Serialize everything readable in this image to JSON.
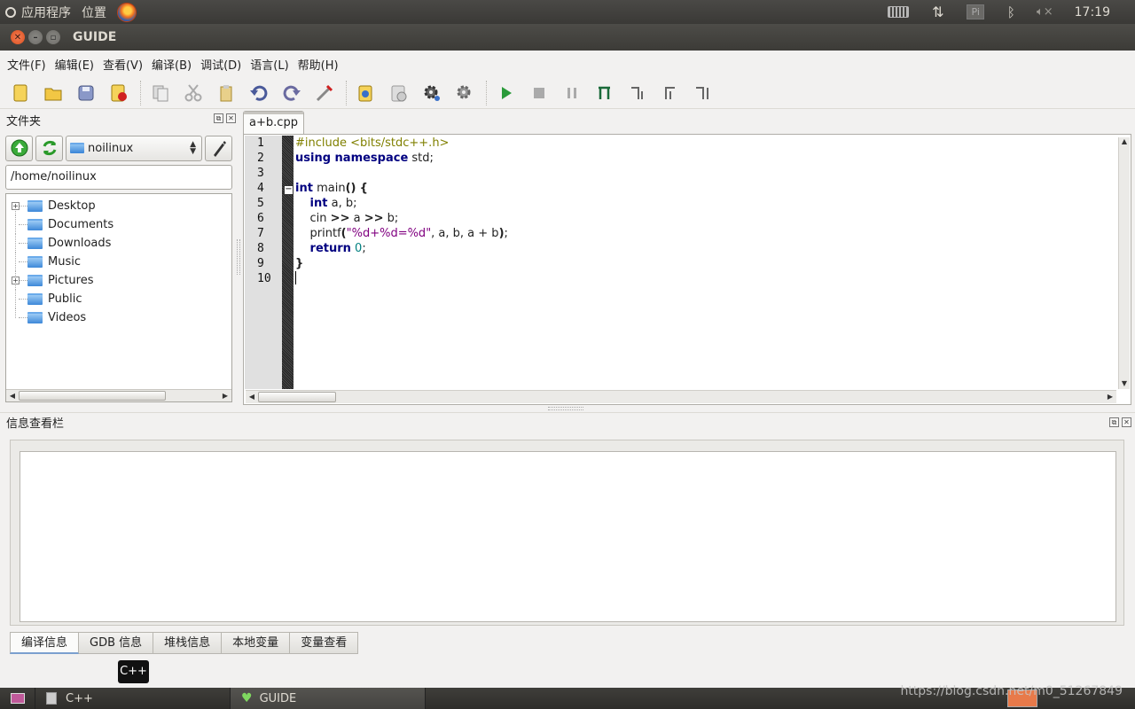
{
  "top_panel": {
    "apps_label": "应用程序",
    "places_label": "位置",
    "time": "17:19",
    "pi_label": "Pi",
    "icons": [
      "ubuntu-logo-icon",
      "firefox-icon",
      "keyboard-icon",
      "network-icon",
      "bluetooth-icon",
      "volume-muted-icon"
    ]
  },
  "window": {
    "title": "GUIDE"
  },
  "menubar": {
    "items": [
      "文件(F)",
      "编辑(E)",
      "查看(V)",
      "编译(B)",
      "调试(D)",
      "语言(L)",
      "帮助(H)"
    ]
  },
  "toolbar": {
    "buttons": [
      "new-file-icon",
      "open-file-icon",
      "save-icon",
      "close-file-icon",
      "copy-icon",
      "cut-icon",
      "paste-icon",
      "undo-icon",
      "redo-icon",
      "compile-settings-icon",
      "build-icon",
      "compile-icon",
      "settings-gear-icon",
      "run-config-icon",
      "run-icon",
      "stop-icon",
      "pause-icon",
      "step-into-icon",
      "step-over-icon",
      "step-out-icon",
      "step-return-icon"
    ]
  },
  "folder_dock": {
    "title": "文件夹",
    "combo_value": "noilinux",
    "path": "/home/noilinux",
    "tree": [
      {
        "label": "Desktop",
        "expandable": true
      },
      {
        "label": "Documents",
        "expandable": false
      },
      {
        "label": "Downloads",
        "expandable": false
      },
      {
        "label": "Music",
        "expandable": false
      },
      {
        "label": "Pictures",
        "expandable": true
      },
      {
        "label": "Public",
        "expandable": false
      },
      {
        "label": "Videos",
        "expandable": false
      }
    ]
  },
  "editor": {
    "tab_label": "a+b.cpp",
    "line_numbers": [
      "1",
      "2",
      "3",
      "4",
      "5",
      "6",
      "7",
      "8",
      "9",
      "10"
    ]
  },
  "info_dock": {
    "title": "信息查看栏",
    "tabs": [
      "编译信息",
      "GDB 信息",
      "堆栈信息",
      "本地变量",
      "变量查看"
    ],
    "active_tab": "编译信息"
  },
  "tooltip": "C++",
  "taskbar": {
    "tasks": [
      "C++",
      "GUIDE"
    ]
  },
  "watermark": "https://blog.csdn.net/m0_51267849",
  "colors": {
    "keyword": "#000080",
    "preprocessor": "#808000",
    "string": "#800080",
    "number": "#008080",
    "panel": "#3c3b37"
  }
}
